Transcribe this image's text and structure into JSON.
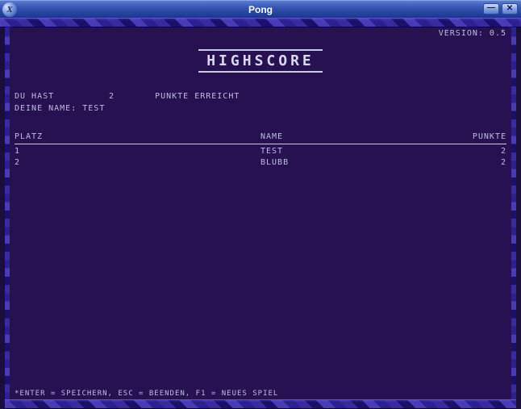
{
  "window": {
    "title": "Pong",
    "icon_letter": "X"
  },
  "version_label": "VERSION: 0.5",
  "heading": "HIGHSCORE",
  "info": {
    "prefix": "DU HAST",
    "points": "2",
    "suffix": "PUNKTE ERREICHT",
    "name_label": "DEINE NAME:",
    "name_value": "TEST"
  },
  "table": {
    "headers": {
      "platz": "PLATZ",
      "name": "NAME",
      "punkte": "PUNKTE"
    },
    "rows": [
      {
        "platz": "1",
        "name": "TEST",
        "punkte": "2"
      },
      {
        "platz": "2",
        "name": "BLUBB",
        "punkte": "2"
      }
    ]
  },
  "footer": "*ENTER = SPEICHERN, ESC = BEENDEN, F1 = NEUES SPIEL"
}
